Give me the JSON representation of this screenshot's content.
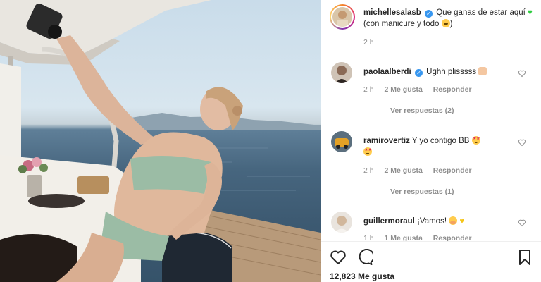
{
  "post": {
    "author": "michellesalasb",
    "caption_part1": "Que ganas de estar aquí",
    "caption_part2": "(con manicure y todo",
    "caption_part3": ")",
    "time": "2 h",
    "likes_count": "12,823",
    "likes_label": "Me gusta"
  },
  "comments": [
    {
      "username": "paolaalberdi",
      "verified": true,
      "text": "Ughh plisssss",
      "time": "2 h",
      "likes": "2 Me gusta",
      "reply": "Responder",
      "view_replies": "Ver respuestas (2)"
    },
    {
      "username": "ramirovertiz",
      "verified": false,
      "text": "Y yo contigo BB",
      "time": "2 h",
      "likes": "2 Me gusta",
      "reply": "Responder",
      "view_replies": "Ver respuestas (1)"
    },
    {
      "username": "guillermoraul",
      "verified": false,
      "text": "¡Vamos!",
      "time": "1 h",
      "likes": "1 Me gusta",
      "reply": "Responder"
    }
  ],
  "icons": {
    "like": "heart-outline-icon",
    "comment": "speech-bubble-icon",
    "save": "bookmark-icon",
    "verified": "verified-badge-icon"
  },
  "colors": {
    "verified": "#3897f0",
    "muted_text": "#8e8e8e",
    "text": "#262626"
  }
}
